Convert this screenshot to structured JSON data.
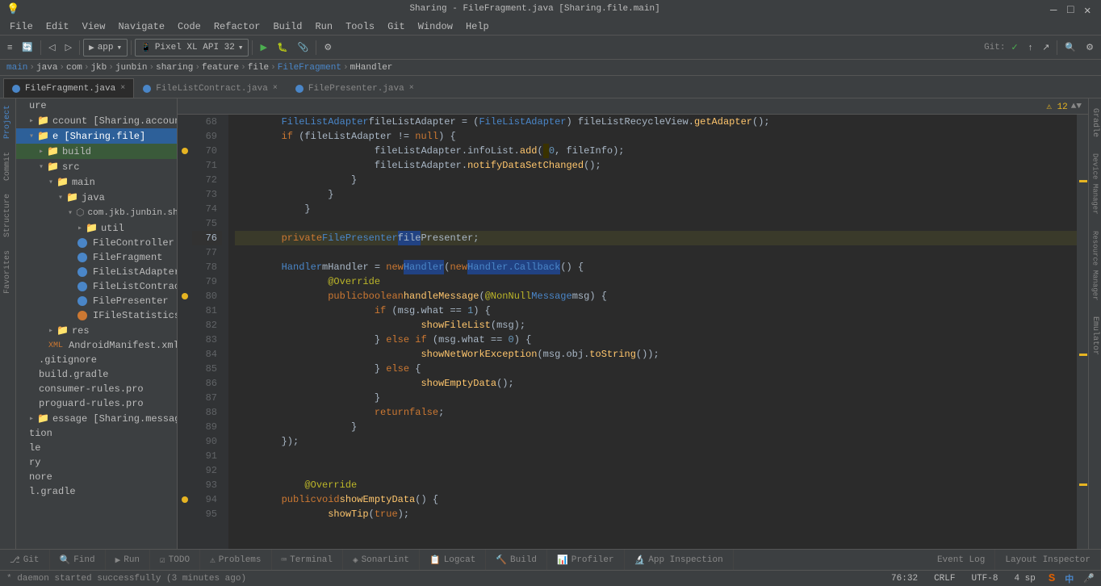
{
  "titleBar": {
    "title": "Sharing - FileFragment.java [Sharing.file.main]",
    "minimize": "—",
    "maximize": "□",
    "close": "✕"
  },
  "menuBar": {
    "items": [
      "File",
      "Edit",
      "View",
      "Navigate",
      "Code",
      "Refactor",
      "Build",
      "Run",
      "Tools",
      "Git",
      "Window",
      "Help"
    ]
  },
  "toolbar": {
    "appLabel": "app",
    "deviceLabel": "Pixel XL API 32",
    "gitLabel": "Git:"
  },
  "breadcrumb": {
    "items": [
      "main",
      "java",
      "com",
      "jkb",
      "junbin",
      "sharing",
      "feature",
      "file",
      "FileFragment",
      "mHandler"
    ]
  },
  "tabs": [
    {
      "label": "FileFragment.java",
      "active": true,
      "icon": "blue"
    },
    {
      "label": "FileListContract.java",
      "active": false,
      "icon": "blue"
    },
    {
      "label": "FilePresenter.java",
      "active": false,
      "icon": "blue"
    }
  ],
  "sidebar": {
    "items": [
      {
        "label": "ure",
        "indent": 0,
        "type": "text"
      },
      {
        "label": "ccount [Sharing.account]",
        "indent": 0,
        "type": "folder"
      },
      {
        "label": "e [Sharing.file]",
        "indent": 0,
        "type": "folder",
        "selected": true
      },
      {
        "label": "build",
        "indent": 1,
        "type": "folder"
      },
      {
        "label": "src",
        "indent": 1,
        "type": "folder"
      },
      {
        "label": "main",
        "indent": 2,
        "type": "folder"
      },
      {
        "label": "java",
        "indent": 3,
        "type": "folder"
      },
      {
        "label": "com.jkb.junbin.shar...",
        "indent": 4,
        "type": "package"
      },
      {
        "label": "util",
        "indent": 5,
        "type": "folder"
      },
      {
        "label": "FileController",
        "indent": 5,
        "type": "java"
      },
      {
        "label": "FileFragment",
        "indent": 5,
        "type": "java"
      },
      {
        "label": "FileListAdapter",
        "indent": 5,
        "type": "java"
      },
      {
        "label": "FileListContract",
        "indent": 5,
        "type": "java"
      },
      {
        "label": "FilePresenter",
        "indent": 5,
        "type": "java"
      },
      {
        "label": "IFileStatisticsImp",
        "indent": 5,
        "type": "java"
      },
      {
        "label": "res",
        "indent": 2,
        "type": "folder"
      },
      {
        "label": "AndroidManifest.xml",
        "indent": 2,
        "type": "xml"
      },
      {
        "label": ".gitignore",
        "indent": 1,
        "type": "file"
      },
      {
        "label": "build.gradle",
        "indent": 1,
        "type": "file"
      },
      {
        "label": "consumer-rules.pro",
        "indent": 1,
        "type": "file"
      },
      {
        "label": "proguard-rules.pro",
        "indent": 1,
        "type": "file"
      },
      {
        "label": "essage [Sharing.message]",
        "indent": 0,
        "type": "folder"
      },
      {
        "label": "tion",
        "indent": 0,
        "type": "text"
      },
      {
        "label": "le",
        "indent": 0,
        "type": "text"
      },
      {
        "label": "ry",
        "indent": 0,
        "type": "text"
      },
      {
        "label": "nore",
        "indent": 0,
        "type": "file"
      },
      {
        "label": "l.gradle",
        "indent": 0,
        "type": "file"
      }
    ]
  },
  "code": {
    "startLine": 68,
    "lines": [
      {
        "num": 68,
        "content": "        FileListAdapter fileListAdapter = (FileListAdapter) fileListRecycleView.getAdapter();",
        "highlight": false
      },
      {
        "num": 69,
        "content": "        if (fileListAdapter != null) {",
        "highlight": false
      },
      {
        "num": 70,
        "content": "            fileListAdapter.infoList.add( 0, fileInfo);",
        "highlight": false,
        "warning": true
      },
      {
        "num": 71,
        "content": "            fileListAdapter.notifyDataSetChanged();",
        "highlight": false
      },
      {
        "num": 72,
        "content": "        }",
        "highlight": false
      },
      {
        "num": 73,
        "content": "    }",
        "highlight": false
      },
      {
        "num": 74,
        "content": "}",
        "highlight": false
      },
      {
        "num": 75,
        "content": "",
        "highlight": false
      },
      {
        "num": 76,
        "content": "    private FilePresenter filePresenter;",
        "highlight": true
      },
      {
        "num": 77,
        "content": "",
        "highlight": false
      },
      {
        "num": 78,
        "content": "    Handler mHandler = new Handler(new Handler.Callback() {",
        "highlight": false
      },
      {
        "num": 79,
        "content": "        @Override",
        "highlight": false
      },
      {
        "num": 80,
        "content": "        public boolean handleMessage(@NonNull Message msg) {",
        "highlight": false,
        "warning": true
      },
      {
        "num": 81,
        "content": "            if (msg.what == 1) {",
        "highlight": false
      },
      {
        "num": 82,
        "content": "                showFileList(msg);",
        "highlight": false
      },
      {
        "num": 83,
        "content": "            } else if (msg.what == 0) {",
        "highlight": false
      },
      {
        "num": 84,
        "content": "                showNetWorkException(msg.obj.toString());",
        "highlight": false
      },
      {
        "num": 85,
        "content": "            } else {",
        "highlight": false
      },
      {
        "num": 86,
        "content": "                showEmptyData();",
        "highlight": false
      },
      {
        "num": 87,
        "content": "            }",
        "highlight": false
      },
      {
        "num": 88,
        "content": "            return false;",
        "highlight": false
      },
      {
        "num": 89,
        "content": "        }",
        "highlight": false
      },
      {
        "num": 90,
        "content": "    });",
        "highlight": false
      },
      {
        "num": 91,
        "content": "",
        "highlight": false
      },
      {
        "num": 92,
        "content": "",
        "highlight": false
      },
      {
        "num": 93,
        "content": "    @Override",
        "highlight": false
      },
      {
        "num": 94,
        "content": "    public void showEmptyData() {",
        "highlight": false,
        "warning": true
      },
      {
        "num": 95,
        "content": "        showTip(true);",
        "highlight": false
      }
    ]
  },
  "bottomTabs": {
    "items": [
      {
        "label": "Git",
        "icon": "git",
        "active": false
      },
      {
        "label": "Find",
        "icon": "find",
        "active": false
      },
      {
        "label": "Run",
        "icon": "run",
        "active": false
      },
      {
        "label": "TODO",
        "icon": "todo",
        "active": false
      },
      {
        "label": "Problems",
        "icon": "problems",
        "active": false
      },
      {
        "label": "Terminal",
        "icon": "terminal",
        "active": false
      },
      {
        "label": "SonarLint",
        "icon": "sonar",
        "active": false
      },
      {
        "label": "Logcat",
        "icon": "logcat",
        "active": false
      },
      {
        "label": "Build",
        "icon": "build",
        "active": false
      },
      {
        "label": "Profiler",
        "icon": "profiler",
        "active": false
      },
      {
        "label": "App Inspection",
        "icon": "inspection",
        "active": false
      }
    ]
  },
  "statusBar": {
    "daemon": "* daemon started successfully (3 minutes ago)",
    "position": "76:32",
    "lineEnding": "CRLF",
    "encoding": "UTF-8",
    "indent": "4 sp",
    "right": [
      "Event Log",
      "Layout Inspector"
    ]
  },
  "warningCount": "12",
  "rightTabs": [
    "Gradle"
  ]
}
